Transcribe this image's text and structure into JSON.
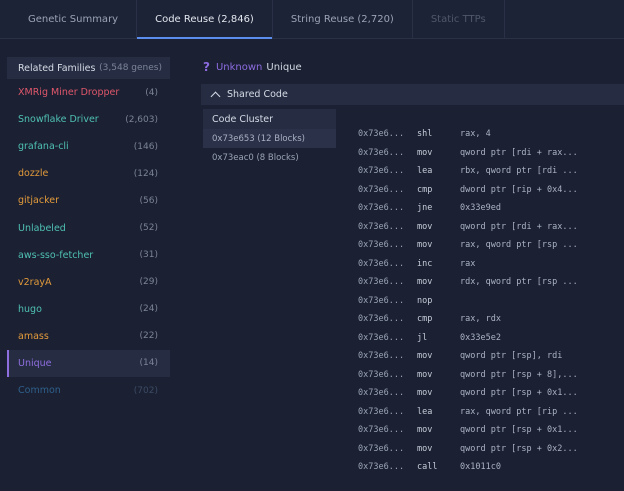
{
  "tabs": [
    {
      "label": "Genetic Summary",
      "state": "normal"
    },
    {
      "label": "Code Reuse (2,846)",
      "state": "active"
    },
    {
      "label": "String Reuse (2,720)",
      "state": "normal"
    },
    {
      "label": "Static TTPs",
      "state": "disabled"
    }
  ],
  "families": {
    "header": {
      "title": "Related Families",
      "count": "(3,548 genes)"
    },
    "items": [
      {
        "name": "XMRig Miner Dropper",
        "count": "(4)",
        "color": "#e0566b"
      },
      {
        "name": "Snowflake Driver",
        "count": "(2,603)",
        "color": "#4fc0b4"
      },
      {
        "name": "grafana-cli",
        "count": "(146)",
        "color": "#4fc0b4"
      },
      {
        "name": "dozzle",
        "count": "(124)",
        "color": "#e39a3b"
      },
      {
        "name": "gitjacker",
        "count": "(56)",
        "color": "#e39a3b"
      },
      {
        "name": "Unlabeled",
        "count": "(52)",
        "color": "#4fc0b4"
      },
      {
        "name": "aws-sso-fetcher",
        "count": "(31)",
        "color": "#4fc0b4"
      },
      {
        "name": "v2rayA",
        "count": "(29)",
        "color": "#e39a3b"
      },
      {
        "name": "hugo",
        "count": "(24)",
        "color": "#4fc0b4"
      },
      {
        "name": "amass",
        "count": "(22)",
        "color": "#e39a3b"
      },
      {
        "name": "Unique",
        "count": "(14)",
        "color": "#8f6ee0"
      },
      {
        "name": "Common",
        "count": "(702)",
        "color": "#2f5f8a"
      }
    ]
  },
  "classification": {
    "label": "Unknown",
    "value": "Unique"
  },
  "shared_code": {
    "title": "Shared Code"
  },
  "code_cluster": {
    "header": "Code Cluster",
    "items": [
      "0x73e653 (12 Blocks)",
      "0x73eac0 (8 Blocks)"
    ]
  },
  "assembly": [
    {
      "addr": "0x73e6...",
      "mn": "shl",
      "op": "rax, 4"
    },
    {
      "addr": "0x73e6...",
      "mn": "mov",
      "op": "qword ptr [rdi + rax..."
    },
    {
      "addr": "0x73e6...",
      "mn": "lea",
      "op": "rbx, qword ptr [rdi ..."
    },
    {
      "addr": "0x73e6...",
      "mn": "cmp",
      "op": "dword ptr [rip + 0x4..."
    },
    {
      "addr": "0x73e6...",
      "mn": "jne",
      "op": "0x33e9ed"
    },
    {
      "addr": "0x73e6...",
      "mn": "mov",
      "op": "qword ptr [rdi + rax..."
    },
    {
      "addr": "0x73e6...",
      "mn": "mov",
      "op": "rax, qword ptr [rsp ..."
    },
    {
      "addr": "0x73e6...",
      "mn": "inc",
      "op": "rax"
    },
    {
      "addr": "0x73e6...",
      "mn": "mov",
      "op": "rdx, qword ptr [rsp ..."
    },
    {
      "addr": "0x73e6...",
      "mn": "nop",
      "op": ""
    },
    {
      "addr": "0x73e6...",
      "mn": "cmp",
      "op": "rax, rdx"
    },
    {
      "addr": "0x73e6...",
      "mn": "jl",
      "op": "0x33e5e2"
    },
    {
      "addr": "0x73e6...",
      "mn": "mov",
      "op": "qword ptr [rsp], rdi"
    },
    {
      "addr": "0x73e6...",
      "mn": "mov",
      "op": "qword ptr [rsp + 8],..."
    },
    {
      "addr": "0x73e6...",
      "mn": "mov",
      "op": "qword ptr [rsp + 0x1..."
    },
    {
      "addr": "0x73e6...",
      "mn": "lea",
      "op": "rax, qword ptr [rip ..."
    },
    {
      "addr": "0x73e6...",
      "mn": "mov",
      "op": "qword ptr [rsp + 0x1..."
    },
    {
      "addr": "0x73e6...",
      "mn": "mov",
      "op": "qword ptr [rsp + 0x2..."
    },
    {
      "addr": "0x73e6...",
      "mn": "call",
      "op": "0x1011c0"
    }
  ]
}
